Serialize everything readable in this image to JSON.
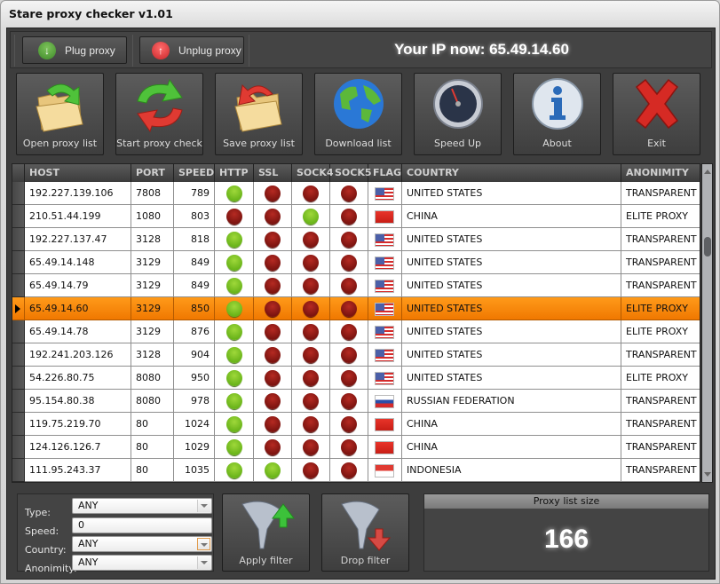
{
  "window": {
    "title": "Stare proxy checker v1.01"
  },
  "topbar": {
    "plug_label": "Plug proxy",
    "unplug_label": "Unplug proxy",
    "ip_text": "Your IP now: 65.49.14.60"
  },
  "toolbar": {
    "buttons": [
      {
        "label": "Open proxy list",
        "icon": "folder-open-icon"
      },
      {
        "label": "Start proxy check",
        "icon": "refresh-arrows-icon"
      },
      {
        "label": "Save proxy list",
        "icon": "folder-save-icon"
      },
      {
        "label": "Download list",
        "icon": "globe-icon"
      },
      {
        "label": "Speed Up",
        "icon": "gauge-icon"
      },
      {
        "label": "About",
        "icon": "info-icon"
      },
      {
        "label": "Exit",
        "icon": "close-x-icon"
      }
    ]
  },
  "grid": {
    "columns": [
      "HOST",
      "PORT",
      "SPEED",
      "HTTP",
      "SSL",
      "SOCK4",
      "SOCK5",
      "FLAG",
      "COUNTRY",
      "ANONIMITY"
    ],
    "selected_index": 5,
    "rows": [
      {
        "host": "192.227.139.106",
        "port": "7808",
        "speed": "789",
        "http": true,
        "ssl": false,
        "sock4": false,
        "sock5": false,
        "flag": "US",
        "country": "UNITED STATES",
        "anonimity": "TRANSPARENT"
      },
      {
        "host": "210.51.44.199",
        "port": "1080",
        "speed": "803",
        "http": false,
        "ssl": false,
        "sock4": true,
        "sock5": false,
        "flag": "CN",
        "country": "CHINA",
        "anonimity": "ELITE PROXY"
      },
      {
        "host": "192.227.137.47",
        "port": "3128",
        "speed": "818",
        "http": true,
        "ssl": false,
        "sock4": false,
        "sock5": false,
        "flag": "US",
        "country": "UNITED STATES",
        "anonimity": "TRANSPARENT"
      },
      {
        "host": "65.49.14.148",
        "port": "3129",
        "speed": "849",
        "http": true,
        "ssl": false,
        "sock4": false,
        "sock5": false,
        "flag": "US",
        "country": "UNITED STATES",
        "anonimity": "TRANSPARENT"
      },
      {
        "host": "65.49.14.79",
        "port": "3129",
        "speed": "849",
        "http": true,
        "ssl": false,
        "sock4": false,
        "sock5": false,
        "flag": "US",
        "country": "UNITED STATES",
        "anonimity": "TRANSPARENT"
      },
      {
        "host": "65.49.14.60",
        "port": "3129",
        "speed": "850",
        "http": true,
        "ssl": false,
        "sock4": false,
        "sock5": false,
        "flag": "US",
        "country": "UNITED STATES",
        "anonimity": "ELITE PROXY"
      },
      {
        "host": "65.49.14.78",
        "port": "3129",
        "speed": "876",
        "http": true,
        "ssl": false,
        "sock4": false,
        "sock5": false,
        "flag": "US",
        "country": "UNITED STATES",
        "anonimity": "ELITE PROXY"
      },
      {
        "host": "192.241.203.126",
        "port": "3128",
        "speed": "904",
        "http": true,
        "ssl": false,
        "sock4": false,
        "sock5": false,
        "flag": "US",
        "country": "UNITED STATES",
        "anonimity": "TRANSPARENT"
      },
      {
        "host": "54.226.80.75",
        "port": "8080",
        "speed": "950",
        "http": true,
        "ssl": false,
        "sock4": false,
        "sock5": false,
        "flag": "US",
        "country": "UNITED STATES",
        "anonimity": "ELITE PROXY"
      },
      {
        "host": "95.154.80.38",
        "port": "8080",
        "speed": "978",
        "http": true,
        "ssl": false,
        "sock4": false,
        "sock5": false,
        "flag": "RU",
        "country": "RUSSIAN FEDERATION",
        "anonimity": "TRANSPARENT"
      },
      {
        "host": "119.75.219.70",
        "port": "80",
        "speed": "1024",
        "http": true,
        "ssl": false,
        "sock4": false,
        "sock5": false,
        "flag": "CN",
        "country": "CHINA",
        "anonimity": "TRANSPARENT"
      },
      {
        "host": "124.126.126.7",
        "port": "80",
        "speed": "1029",
        "http": true,
        "ssl": false,
        "sock4": false,
        "sock5": false,
        "flag": "CN",
        "country": "CHINA",
        "anonimity": "TRANSPARENT"
      },
      {
        "host": "111.95.243.37",
        "port": "80",
        "speed": "1035",
        "http": true,
        "ssl": true,
        "sock4": false,
        "sock5": false,
        "flag": "ID",
        "country": "INDONESIA",
        "anonimity": "TRANSPARENT"
      }
    ]
  },
  "filter": {
    "type_label": "Type:",
    "type_value": "ANY",
    "speed_label": "Speed:",
    "speed_value": "0",
    "country_label": "Country:",
    "country_value": "ANY",
    "anonimity_label": "Anonimity:",
    "anonimity_value": "ANY",
    "apply_label": "Apply filter",
    "drop_label": "Drop filter"
  },
  "summary": {
    "title": "Proxy list size",
    "value": "166"
  },
  "colors": {
    "accent_selected": "#f58a0a",
    "ok": "#7cc226",
    "fail": "#9a1d16",
    "panel": "#3d3d3d"
  }
}
